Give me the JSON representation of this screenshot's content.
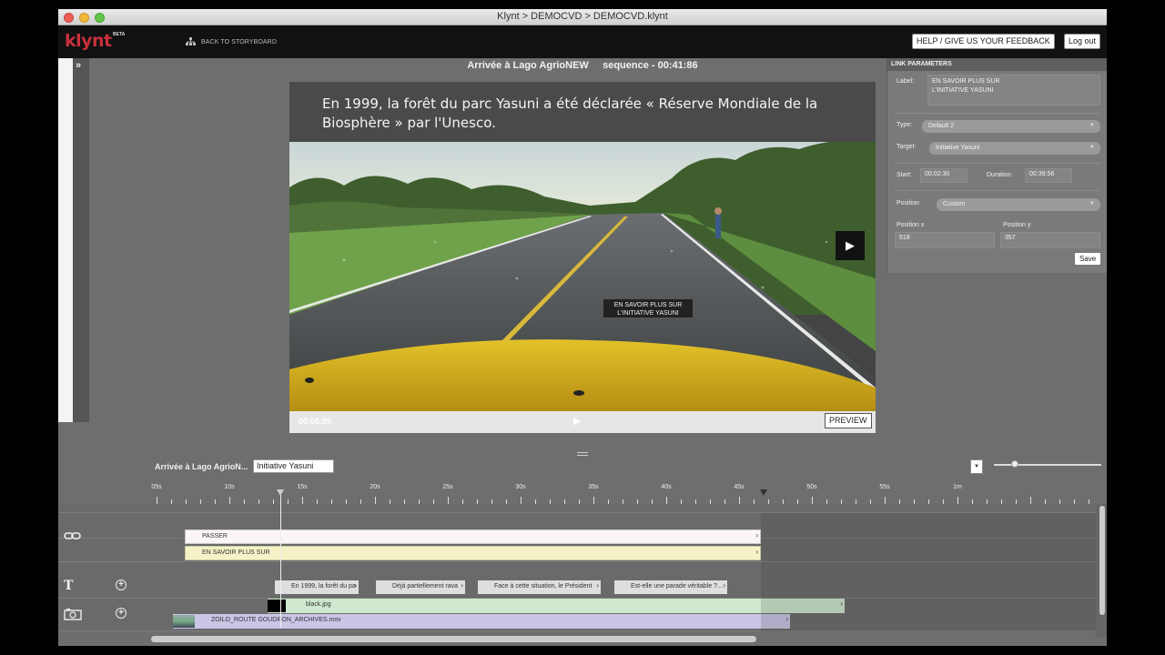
{
  "window": {
    "title": "Klynt > DEMOCVD > DEMOCVD.klynt"
  },
  "header": {
    "logo": "klynt",
    "logo_badge": "BETA",
    "back_to_storyboard": "BACK TO STORYBOARD",
    "help_button": "HELP / GIVE US YOUR FEEDBACK",
    "logout_button": "Log out"
  },
  "left_panel": {
    "expand_glyph": "»"
  },
  "sequence": {
    "title": "Arrivée à Lago AgrioNEW",
    "duration_label": "sequence - 00:41:86"
  },
  "video": {
    "caption": "En 1999, la forêt du parc Yasuni a été déclarée « Réserve Mondiale de la Biosphère » par l'Unesco.",
    "link_overlay_line1": "EN SAVOIR PLUS SUR",
    "link_overlay_line2": "L'INITIATIVE YASUNI",
    "timecode": "00:08:85",
    "preview_button": "PREVIEW",
    "progress": 0.21
  },
  "link_params": {
    "heading": "LINK PARAMETERS",
    "label_label": "Label:",
    "label_value_line1": "EN SAVOIR PLUS SUR",
    "label_value_line2": "L'INITIATIVE YASUNI",
    "type_label": "Type:",
    "type_value": "Default 2",
    "target_label": "Target:",
    "target_value": "Initiative Yasuni",
    "start_label": "Start:",
    "start_value": "00:02:30",
    "duration_label": "Duration:",
    "duration_value": "00:39:56",
    "position_label": "Position",
    "position_value": "Custom",
    "posx_label": "Position x",
    "posx_value": "518",
    "posy_label": "Position y",
    "posy_value": "357",
    "save_button": "Save"
  },
  "timeline": {
    "crumb": "Arrivée à Lago AgrioN...",
    "crumb_value": "Initiative Yasuni",
    "ruler_labels": [
      "05s",
      "10s",
      "15s",
      "20s",
      "25s",
      "30s",
      "35s",
      "40s",
      "45s",
      "50s",
      "55s",
      "1m"
    ],
    "link_clips": [
      "PASSER",
      "EN SAVOIR PLUS SUR"
    ],
    "text_clips": [
      "En 1999, la forêt du pa",
      "Déjà partiellement rava",
      "Face à cette situation, le Président",
      "Est-elle une parade véritable ?..."
    ],
    "media_clips": [
      "black.jpg",
      "ZOILO_ROUTE GOUDRON_ARCHIVES.mov"
    ]
  },
  "icons": {
    "link": "link-icon",
    "text": "text-icon",
    "media": "media-icon",
    "add": "add-icon",
    "storyboard": "storyboard-icon",
    "play": "play-icon"
  },
  "colors": {
    "brand": "#c8303a",
    "link_track_passer": "#fbf5f5",
    "link_track_yasuni": "#f6f2c8",
    "image_clip": "#cfe8cf",
    "video_clip": "#c9c6e6"
  }
}
